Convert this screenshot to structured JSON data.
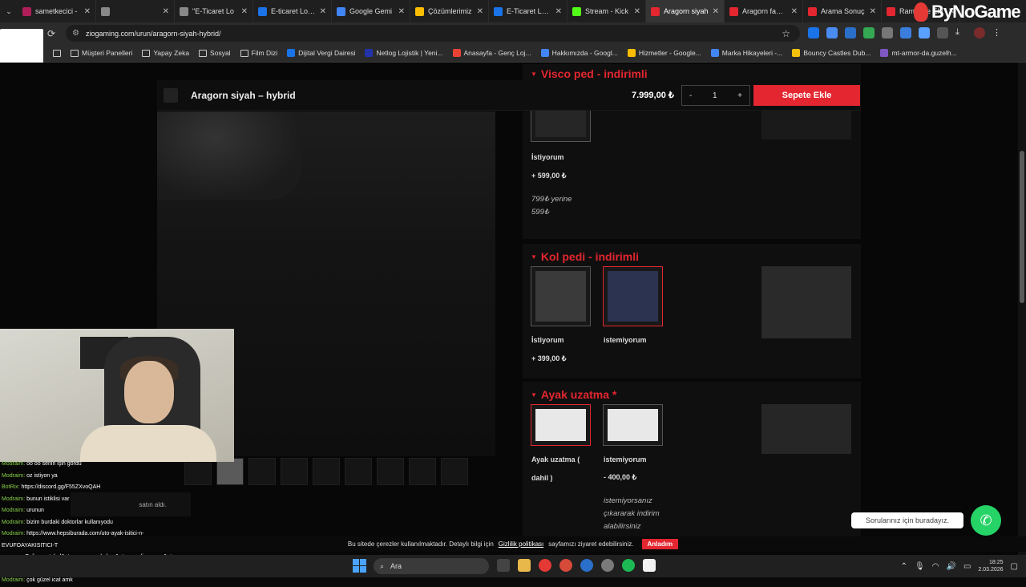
{
  "tabs": [
    {
      "label": "sametkecici -",
      "color": "#b01e5a"
    },
    {
      "label": "",
      "color": "#888"
    },
    {
      "label": "\"E-Ticaret Lo",
      "color": "#888"
    },
    {
      "label": "E-ticaret Lojisti",
      "color": "#1a73e8"
    },
    {
      "label": "Google Gemi",
      "color": "#4285f4"
    },
    {
      "label": "Çözümlerimiz",
      "color": "#fbbc04"
    },
    {
      "label": "E-Ticaret Lojisti",
      "color": "#1a73e8"
    },
    {
      "label": "Stream - Kick",
      "color": "#53fc18"
    },
    {
      "label": "Aragorn siyah",
      "color": "#e3262f"
    },
    {
      "label": "Aragorn fabric",
      "color": "#e3262f"
    },
    {
      "label": "Arama Sonuç",
      "color": "#e3262f"
    },
    {
      "label": "Rampage Ele",
      "color": "#e3262f"
    }
  ],
  "brand": "ByNoGame",
  "url": "ziogaming.com/urun/aragorn-siyah-hybrid/",
  "bookmarks": [
    "Müşteri Panelleri",
    "Yapay Zeka",
    "Sosyal",
    "Film Dizi",
    "Dijital Vergi Dairesi",
    "Netlog Lojistik | Yeni...",
    "Anasayfa - Genç Loj...",
    "Hakkımızda - Googl...",
    "Hizmetler - Google...",
    "Marka Hikayeleri -...",
    "Bouncy Castles Dub...",
    "mt-armor-da.guzelh..."
  ],
  "product": {
    "name": "Aragorn siyah – hybrid",
    "price": "7.999,00 ₺",
    "qty": "1",
    "minus": "-",
    "plus": "+",
    "add_to_cart": "Sepete Ekle"
  },
  "sections": {
    "visco": {
      "title": "Visco ped - indirimli",
      "opt_label": "İstiyorum",
      "opt_price": "+ 599,00 ₺",
      "note1": "799₺ yerine",
      "note2": "599₺"
    },
    "kol": {
      "title": "Kol pedi - indirimli",
      "opt1": "İstiyorum",
      "opt1_price": "+ 399,00 ₺",
      "opt2": "istemiyorum"
    },
    "ayak": {
      "title": "Ayak uzatma *",
      "opt1_a": "Ayak uzatma (",
      "opt1_b": "dahil )",
      "opt2": "istemiyorum",
      "opt2_price": "- 400,00 ₺",
      "note1": "istemiyorsanız",
      "note2": "çıkararak indirim",
      "note3": "alabilirsiniz"
    }
  },
  "cookie": {
    "text": "Bu sitede çerezler kullanılmaktadır. Detaylı bilgi için",
    "link": "Gizlilik politikası",
    "text2": "sayfamızı ziyaret edebilirsiniz.",
    "button": "Anladım"
  },
  "chat_bubble": "Sorularınız için buradayız.",
  "buyer_note": "satın aldı.",
  "chat": [
    {
      "u": "Modraim:",
      "m": "oo oo senin işin gördü"
    },
    {
      "u": "Modraim:",
      "m": "oz istiyon ya"
    },
    {
      "u": "BotRix:",
      "m": "https://discord.gg/F55ZXvoQAH"
    },
    {
      "u": "Modraim:",
      "m": "bunun istiklisi var"
    },
    {
      "u": "Modraim:",
      "m": "urunun"
    },
    {
      "u": "Modraim:",
      "m": "bizim burdaki doktorlar kullanıyodu"
    },
    {
      "u": "Modraim:",
      "m": "https://www.hepsiburada.com/uto-ayak-isitici-n-"
    },
    {
      "u": "",
      "m": "EVUFOAYAKISITICI-T"
    },
    {
      "u": "",
      "m": "magaza=Onlineportakal&utm_source=akakce&utm_medium=cpc&utm_ca"
    },
    {
      "u": "",
      "m": "ecom=Akakce.md%3Apricecomp&utm_content=cgnm%3Ahb&wt_pc=a"
    },
    {
      "u": "Modraim:",
      "m": "çok güzel icat amk"
    }
  ],
  "taskbar": {
    "search": "Ara",
    "time": "18:25",
    "date": "2.03.2026"
  }
}
